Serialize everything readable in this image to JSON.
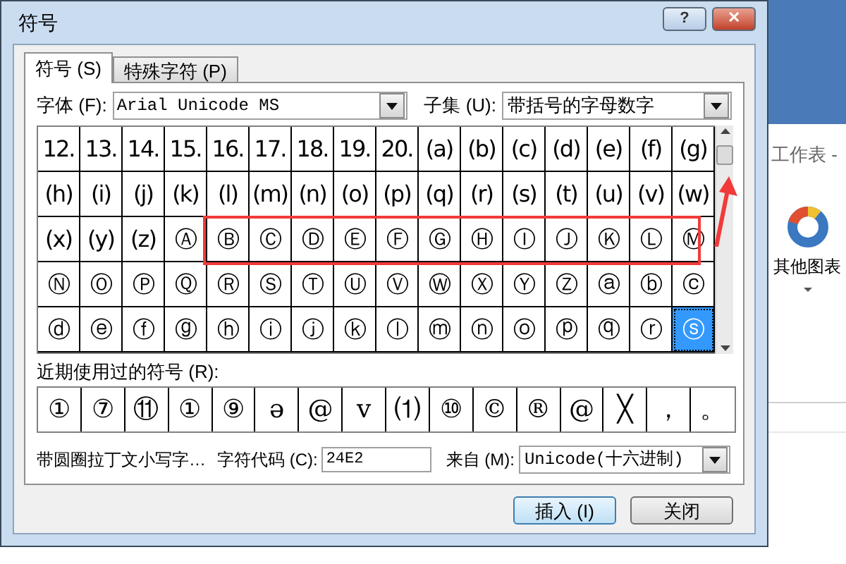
{
  "window": {
    "title": "符号"
  },
  "title_buttons": [
    {
      "kind": "help",
      "label": "?"
    },
    {
      "kind": "close",
      "label": "✕"
    }
  ],
  "tabs": [
    {
      "label": "符号 (S)",
      "selected": true
    },
    {
      "label": "特殊字符 (P)",
      "selected": false
    }
  ],
  "font": {
    "label": "字体 (F):",
    "value": "Arial Unicode MS"
  },
  "subset": {
    "label": "子集 (U):",
    "value": "带括号的字母数字"
  },
  "symbols": [
    [
      {
        "char": "12.",
        "selected": false
      },
      {
        "char": "13.",
        "selected": false
      },
      {
        "char": "14.",
        "selected": false
      },
      {
        "char": "15.",
        "selected": false
      },
      {
        "char": "16.",
        "selected": false
      },
      {
        "char": "17.",
        "selected": false
      },
      {
        "char": "18.",
        "selected": false
      },
      {
        "char": "19.",
        "selected": false
      },
      {
        "char": "20.",
        "selected": false
      },
      {
        "char": "(a)",
        "selected": false
      },
      {
        "char": "(b)",
        "selected": false
      },
      {
        "char": "(c)",
        "selected": false
      },
      {
        "char": "(d)",
        "selected": false
      },
      {
        "char": "(e)",
        "selected": false
      },
      {
        "char": "(f)",
        "selected": false
      },
      {
        "char": "(g)",
        "selected": false
      }
    ],
    [
      {
        "char": "(h)",
        "selected": false
      },
      {
        "char": "(i)",
        "selected": false
      },
      {
        "char": "(j)",
        "selected": false
      },
      {
        "char": "(k)",
        "selected": false
      },
      {
        "char": "(l)",
        "selected": false
      },
      {
        "char": "(m)",
        "selected": false
      },
      {
        "char": "(n)",
        "selected": false
      },
      {
        "char": "(o)",
        "selected": false
      },
      {
        "char": "(p)",
        "selected": false
      },
      {
        "char": "(q)",
        "selected": false
      },
      {
        "char": "(r)",
        "selected": false
      },
      {
        "char": "(s)",
        "selected": false
      },
      {
        "char": "(t)",
        "selected": false
      },
      {
        "char": "(u)",
        "selected": false
      },
      {
        "char": "(v)",
        "selected": false
      },
      {
        "char": "(w)",
        "selected": false
      }
    ],
    [
      {
        "char": "(x)",
        "selected": false
      },
      {
        "char": "(y)",
        "selected": false
      },
      {
        "char": "(z)",
        "selected": false
      },
      {
        "char": "Ⓐ",
        "selected": false
      },
      {
        "char": "Ⓑ",
        "selected": false
      },
      {
        "char": "Ⓒ",
        "selected": false
      },
      {
        "char": "Ⓓ",
        "selected": false
      },
      {
        "char": "Ⓔ",
        "selected": false
      },
      {
        "char": "Ⓕ",
        "selected": false
      },
      {
        "char": "Ⓖ",
        "selected": false
      },
      {
        "char": "Ⓗ",
        "selected": false
      },
      {
        "char": "Ⓘ",
        "selected": false
      },
      {
        "char": "Ⓙ",
        "selected": false
      },
      {
        "char": "Ⓚ",
        "selected": false
      },
      {
        "char": "Ⓛ",
        "selected": false
      },
      {
        "char": "Ⓜ",
        "selected": false
      }
    ],
    [
      {
        "char": "Ⓝ",
        "selected": false
      },
      {
        "char": "Ⓞ",
        "selected": false
      },
      {
        "char": "Ⓟ",
        "selected": false
      },
      {
        "char": "Ⓠ",
        "selected": false
      },
      {
        "char": "Ⓡ",
        "selected": false
      },
      {
        "char": "Ⓢ",
        "selected": false
      },
      {
        "char": "Ⓣ",
        "selected": false
      },
      {
        "char": "Ⓤ",
        "selected": false
      },
      {
        "char": "Ⓥ",
        "selected": false
      },
      {
        "char": "Ⓦ",
        "selected": false
      },
      {
        "char": "Ⓧ",
        "selected": false
      },
      {
        "char": "Ⓨ",
        "selected": false
      },
      {
        "char": "Ⓩ",
        "selected": false
      },
      {
        "char": "ⓐ",
        "selected": false
      },
      {
        "char": "ⓑ",
        "selected": false
      },
      {
        "char": "ⓒ",
        "selected": false
      }
    ],
    [
      {
        "char": "ⓓ",
        "selected": false
      },
      {
        "char": "ⓔ",
        "selected": false
      },
      {
        "char": "ⓕ",
        "selected": false
      },
      {
        "char": "ⓖ",
        "selected": false
      },
      {
        "char": "ⓗ",
        "selected": false
      },
      {
        "char": "ⓘ",
        "selected": false
      },
      {
        "char": "ⓙ",
        "selected": false
      },
      {
        "char": "ⓚ",
        "selected": false
      },
      {
        "char": "ⓛ",
        "selected": false
      },
      {
        "char": "ⓜ",
        "selected": false
      },
      {
        "char": "ⓝ",
        "selected": false
      },
      {
        "char": "ⓞ",
        "selected": false
      },
      {
        "char": "ⓟ",
        "selected": false
      },
      {
        "char": "ⓠ",
        "selected": false
      },
      {
        "char": "ⓡ",
        "selected": false
      },
      {
        "char": "ⓢ",
        "selected": true
      }
    ]
  ],
  "recent": {
    "label": "近期使用过的符号 (R):",
    "items": [
      "①",
      "⑦",
      "⑪",
      "①",
      "⑨",
      "ə",
      "@",
      "v",
      "⑴",
      "⑩",
      "©",
      "®",
      "@",
      "╳",
      "，",
      "。"
    ]
  },
  "char_name": "带圆圈拉丁文小写字…",
  "char_code": {
    "label": "字符代码 (C):",
    "value": "24E2"
  },
  "from": {
    "label": "来自 (M):",
    "value": "Unicode(十六进制)"
  },
  "buttons": [
    {
      "label": "插入 (I)",
      "kind": "default"
    },
    {
      "label": "关闭",
      "kind": "normal"
    }
  ],
  "background": {
    "sheet_title": "工作表 -",
    "chart_button": "其他图表"
  }
}
